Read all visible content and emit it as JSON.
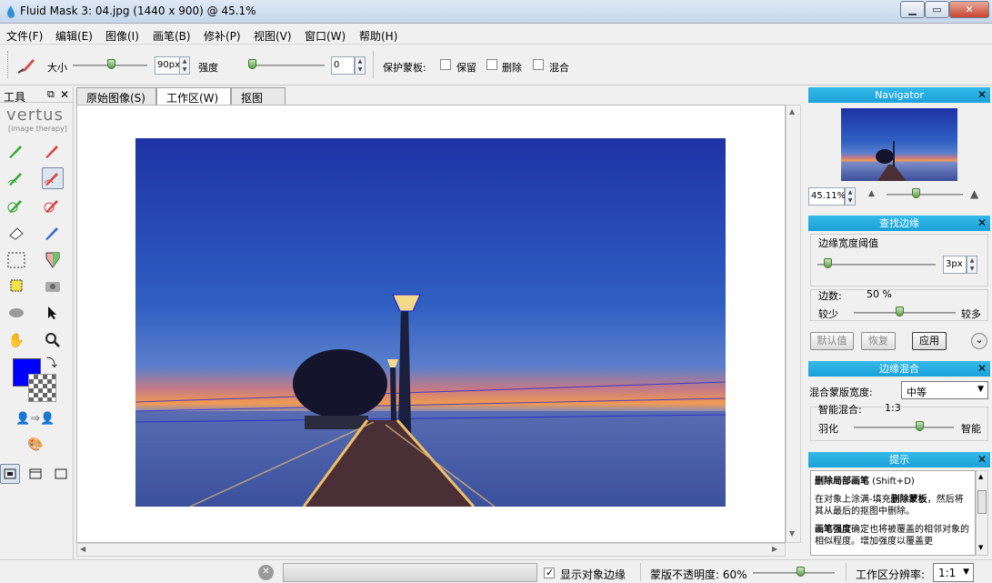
{
  "window": {
    "title": "Fluid Mask 3: 04.jpg (1440 x 900) @ 45.1%"
  },
  "menu": [
    "文件(F)",
    "编辑(E)",
    "图像(I)",
    "画笔(B)",
    "修补(P)",
    "视图(V)",
    "窗口(W)",
    "帮助(H)"
  ],
  "options": {
    "size_label": "大小",
    "size_value": "90px",
    "size_level": 0.5,
    "strength_label": "强度",
    "strength_value": "0",
    "strength_level": 0.0,
    "protect_label": "保护蒙板:",
    "keep_label": "保留",
    "delete_label": "删除",
    "blend_label": "混合"
  },
  "tools": {
    "title": "工具",
    "logo": "vertus",
    "logo_sub": "[image therapy]",
    "fg_color": "#0000ff",
    "accent": "#1aa1d8"
  },
  "tabs": [
    "原始图像(S)",
    "工作区(W)",
    "抠图(C)"
  ],
  "navigator": {
    "title": "Navigator",
    "zoom": "45.11%"
  },
  "find_edges": {
    "title": "查找边缘",
    "threshold_label": "边缘宽度阈值",
    "threshold_value": "3px",
    "count_label": "边数:",
    "count_value": "50 %",
    "less_label": "较少",
    "more_label": "较多",
    "default_btn": "默认值",
    "restore_btn": "恢复",
    "apply_btn": "应用"
  },
  "edge_blend": {
    "title": "边缘混合",
    "width_label": "混合蒙版宽度:",
    "width_value": "中等",
    "smart_label": "智能混合:",
    "smart_value": "1:3",
    "feather_label": "羽化",
    "smart_right": "智能"
  },
  "hint": {
    "title": "提示",
    "line1_bold": "删除局部画笔",
    "line1_rest": " (Shift+D)",
    "para1a": "在对象上涂满-填充",
    "para1b": "删除蒙板",
    "para1c": "，然后将其从最后的抠图中删除。",
    "para2a": "画笔强度",
    "para2b": "确定也将被覆盖的相邻对象的相似程度。增加强度以覆盖更"
  },
  "status": {
    "show_edges_label": "显示对象边缘",
    "opacity_label": "蒙版不透明度: 60%",
    "resolution_label": "工作区分辨率:",
    "resolution_value": "1:1"
  }
}
